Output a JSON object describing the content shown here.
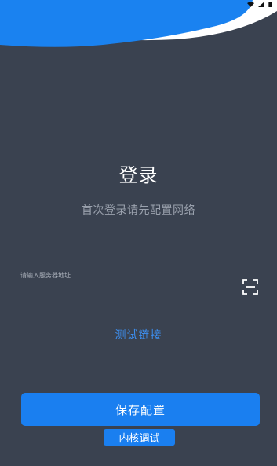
{
  "status_bar": {
    "icons": [
      "wifi-icon",
      "signal-icon",
      "battery-icon"
    ]
  },
  "header": {
    "title": "登录",
    "subtitle": "首次登录请先配置网络"
  },
  "form": {
    "server_label": "请输入服务器地址",
    "server_value": "",
    "scan_icon": "scan-icon",
    "test_link": "测试链接"
  },
  "actions": {
    "save_label": "保存配置",
    "debug_label": "内核调试"
  },
  "colors": {
    "background": "#3a4250",
    "accent": "#1a7ff0",
    "link": "#3d8ff0",
    "wave_light": "#ffffff"
  }
}
